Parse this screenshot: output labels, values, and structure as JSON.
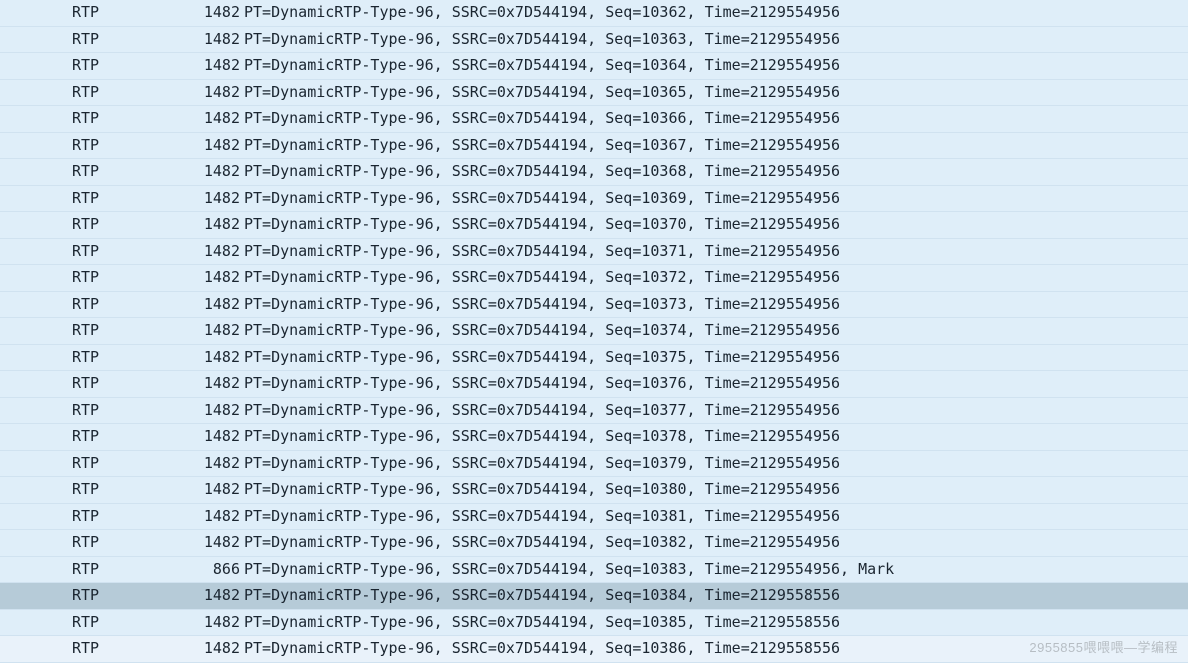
{
  "watermark": "2955855喂喂喂—学编程",
  "packets": [
    {
      "protocol": "RTP",
      "length": "1482",
      "info": "PT=DynamicRTP-Type-96, SSRC=0x7D544194, Seq=10362, Time=2129554956",
      "selected": false
    },
    {
      "protocol": "RTP",
      "length": "1482",
      "info": "PT=DynamicRTP-Type-96, SSRC=0x7D544194, Seq=10363, Time=2129554956",
      "selected": false
    },
    {
      "protocol": "RTP",
      "length": "1482",
      "info": "PT=DynamicRTP-Type-96, SSRC=0x7D544194, Seq=10364, Time=2129554956",
      "selected": false
    },
    {
      "protocol": "RTP",
      "length": "1482",
      "info": "PT=DynamicRTP-Type-96, SSRC=0x7D544194, Seq=10365, Time=2129554956",
      "selected": false
    },
    {
      "protocol": "RTP",
      "length": "1482",
      "info": "PT=DynamicRTP-Type-96, SSRC=0x7D544194, Seq=10366, Time=2129554956",
      "selected": false
    },
    {
      "protocol": "RTP",
      "length": "1482",
      "info": "PT=DynamicRTP-Type-96, SSRC=0x7D544194, Seq=10367, Time=2129554956",
      "selected": false
    },
    {
      "protocol": "RTP",
      "length": "1482",
      "info": "PT=DynamicRTP-Type-96, SSRC=0x7D544194, Seq=10368, Time=2129554956",
      "selected": false
    },
    {
      "protocol": "RTP",
      "length": "1482",
      "info": "PT=DynamicRTP-Type-96, SSRC=0x7D544194, Seq=10369, Time=2129554956",
      "selected": false
    },
    {
      "protocol": "RTP",
      "length": "1482",
      "info": "PT=DynamicRTP-Type-96, SSRC=0x7D544194, Seq=10370, Time=2129554956",
      "selected": false
    },
    {
      "protocol": "RTP",
      "length": "1482",
      "info": "PT=DynamicRTP-Type-96, SSRC=0x7D544194, Seq=10371, Time=2129554956",
      "selected": false
    },
    {
      "protocol": "RTP",
      "length": "1482",
      "info": "PT=DynamicRTP-Type-96, SSRC=0x7D544194, Seq=10372, Time=2129554956",
      "selected": false
    },
    {
      "protocol": "RTP",
      "length": "1482",
      "info": "PT=DynamicRTP-Type-96, SSRC=0x7D544194, Seq=10373, Time=2129554956",
      "selected": false
    },
    {
      "protocol": "RTP",
      "length": "1482",
      "info": "PT=DynamicRTP-Type-96, SSRC=0x7D544194, Seq=10374, Time=2129554956",
      "selected": false
    },
    {
      "protocol": "RTP",
      "length": "1482",
      "info": "PT=DynamicRTP-Type-96, SSRC=0x7D544194, Seq=10375, Time=2129554956",
      "selected": false
    },
    {
      "protocol": "RTP",
      "length": "1482",
      "info": "PT=DynamicRTP-Type-96, SSRC=0x7D544194, Seq=10376, Time=2129554956",
      "selected": false
    },
    {
      "protocol": "RTP",
      "length": "1482",
      "info": "PT=DynamicRTP-Type-96, SSRC=0x7D544194, Seq=10377, Time=2129554956",
      "selected": false
    },
    {
      "protocol": "RTP",
      "length": "1482",
      "info": "PT=DynamicRTP-Type-96, SSRC=0x7D544194, Seq=10378, Time=2129554956",
      "selected": false
    },
    {
      "protocol": "RTP",
      "length": "1482",
      "info": "PT=DynamicRTP-Type-96, SSRC=0x7D544194, Seq=10379, Time=2129554956",
      "selected": false
    },
    {
      "protocol": "RTP",
      "length": "1482",
      "info": "PT=DynamicRTP-Type-96, SSRC=0x7D544194, Seq=10380, Time=2129554956",
      "selected": false
    },
    {
      "protocol": "RTP",
      "length": "1482",
      "info": "PT=DynamicRTP-Type-96, SSRC=0x7D544194, Seq=10381, Time=2129554956",
      "selected": false
    },
    {
      "protocol": "RTP",
      "length": "1482",
      "info": "PT=DynamicRTP-Type-96, SSRC=0x7D544194, Seq=10382, Time=2129554956",
      "selected": false
    },
    {
      "protocol": "RTP",
      "length": "866",
      "info": "PT=DynamicRTP-Type-96, SSRC=0x7D544194, Seq=10383, Time=2129554956, Mark",
      "selected": false
    },
    {
      "protocol": "RTP",
      "length": "1482",
      "info": "PT=DynamicRTP-Type-96, SSRC=0x7D544194, Seq=10384, Time=2129558556",
      "selected": true
    },
    {
      "protocol": "RTP",
      "length": "1482",
      "info": "PT=DynamicRTP-Type-96, SSRC=0x7D544194, Seq=10385, Time=2129558556",
      "selected": false
    },
    {
      "protocol": "RTP",
      "length": "1482",
      "info": "PT=DynamicRTP-Type-96, SSRC=0x7D544194, Seq=10386, Time=2129558556",
      "selected": false
    }
  ]
}
